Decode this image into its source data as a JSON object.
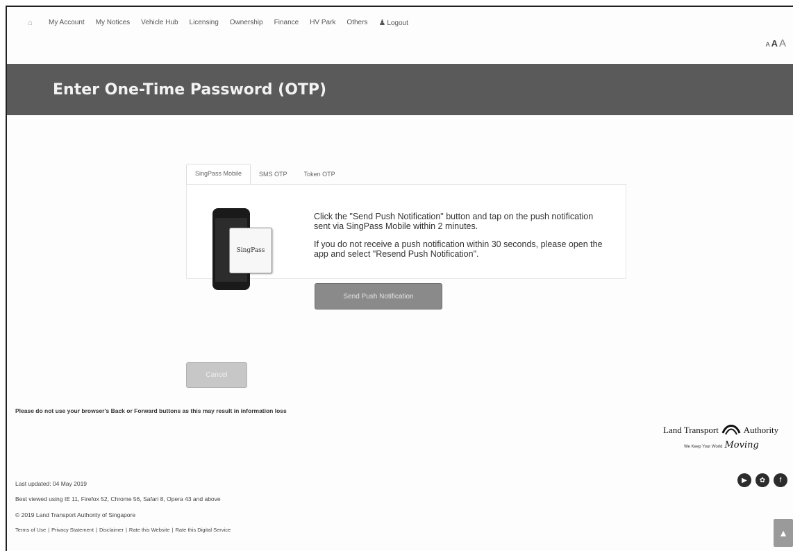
{
  "nav": {
    "items": [
      "My Account",
      "My Notices",
      "Vehicle Hub",
      "Licensing",
      "Ownership",
      "Finance",
      "HV Park",
      "Others"
    ],
    "logout": "Logout"
  },
  "font_size_controls": [
    "A",
    "A",
    "A"
  ],
  "page_title": "Enter One-Time Password (OTP)",
  "tabs": [
    {
      "label": "SingPass Mobile",
      "active": true
    },
    {
      "label": "SMS OTP",
      "active": false
    },
    {
      "label": "Token OTP",
      "active": false
    }
  ],
  "phone_card_label": "SingPass",
  "instructions": {
    "p1": "Click the \"Send Push Notification\" button and tap on the push notification sent via SingPass Mobile within 2 minutes.",
    "p2": "If you do not receive a push notification within 30 seconds, please open the app and select \"Resend Push Notification\"."
  },
  "send_button": "Send Push Notification",
  "cancel_button": "Cancel",
  "warning": "Please do not use your browser's Back or Forward buttons as this may result in information loss",
  "footer": {
    "last_updated": "Last updated: 04 May 2019",
    "best_viewed": "Best viewed using IE 11, Firefox 52, Chrome 56, Safari 8, Opera 43 and above",
    "copyright": "© 2019 Land Transport Authority of Singapore",
    "links": [
      "Terms of Use",
      "Privacy Statement",
      "Disclaimer",
      "Rate this Website",
      "Rate this Digital Service"
    ]
  },
  "logo": {
    "name_left": "Land Transport",
    "name_right": "Authority",
    "tagline": "We Keep Your World",
    "tagline_script": "Moving"
  },
  "colors": {
    "banner": "#5a5a5a",
    "send_button": "#8a8a8a",
    "cancel_button": "#c7c7c7"
  }
}
